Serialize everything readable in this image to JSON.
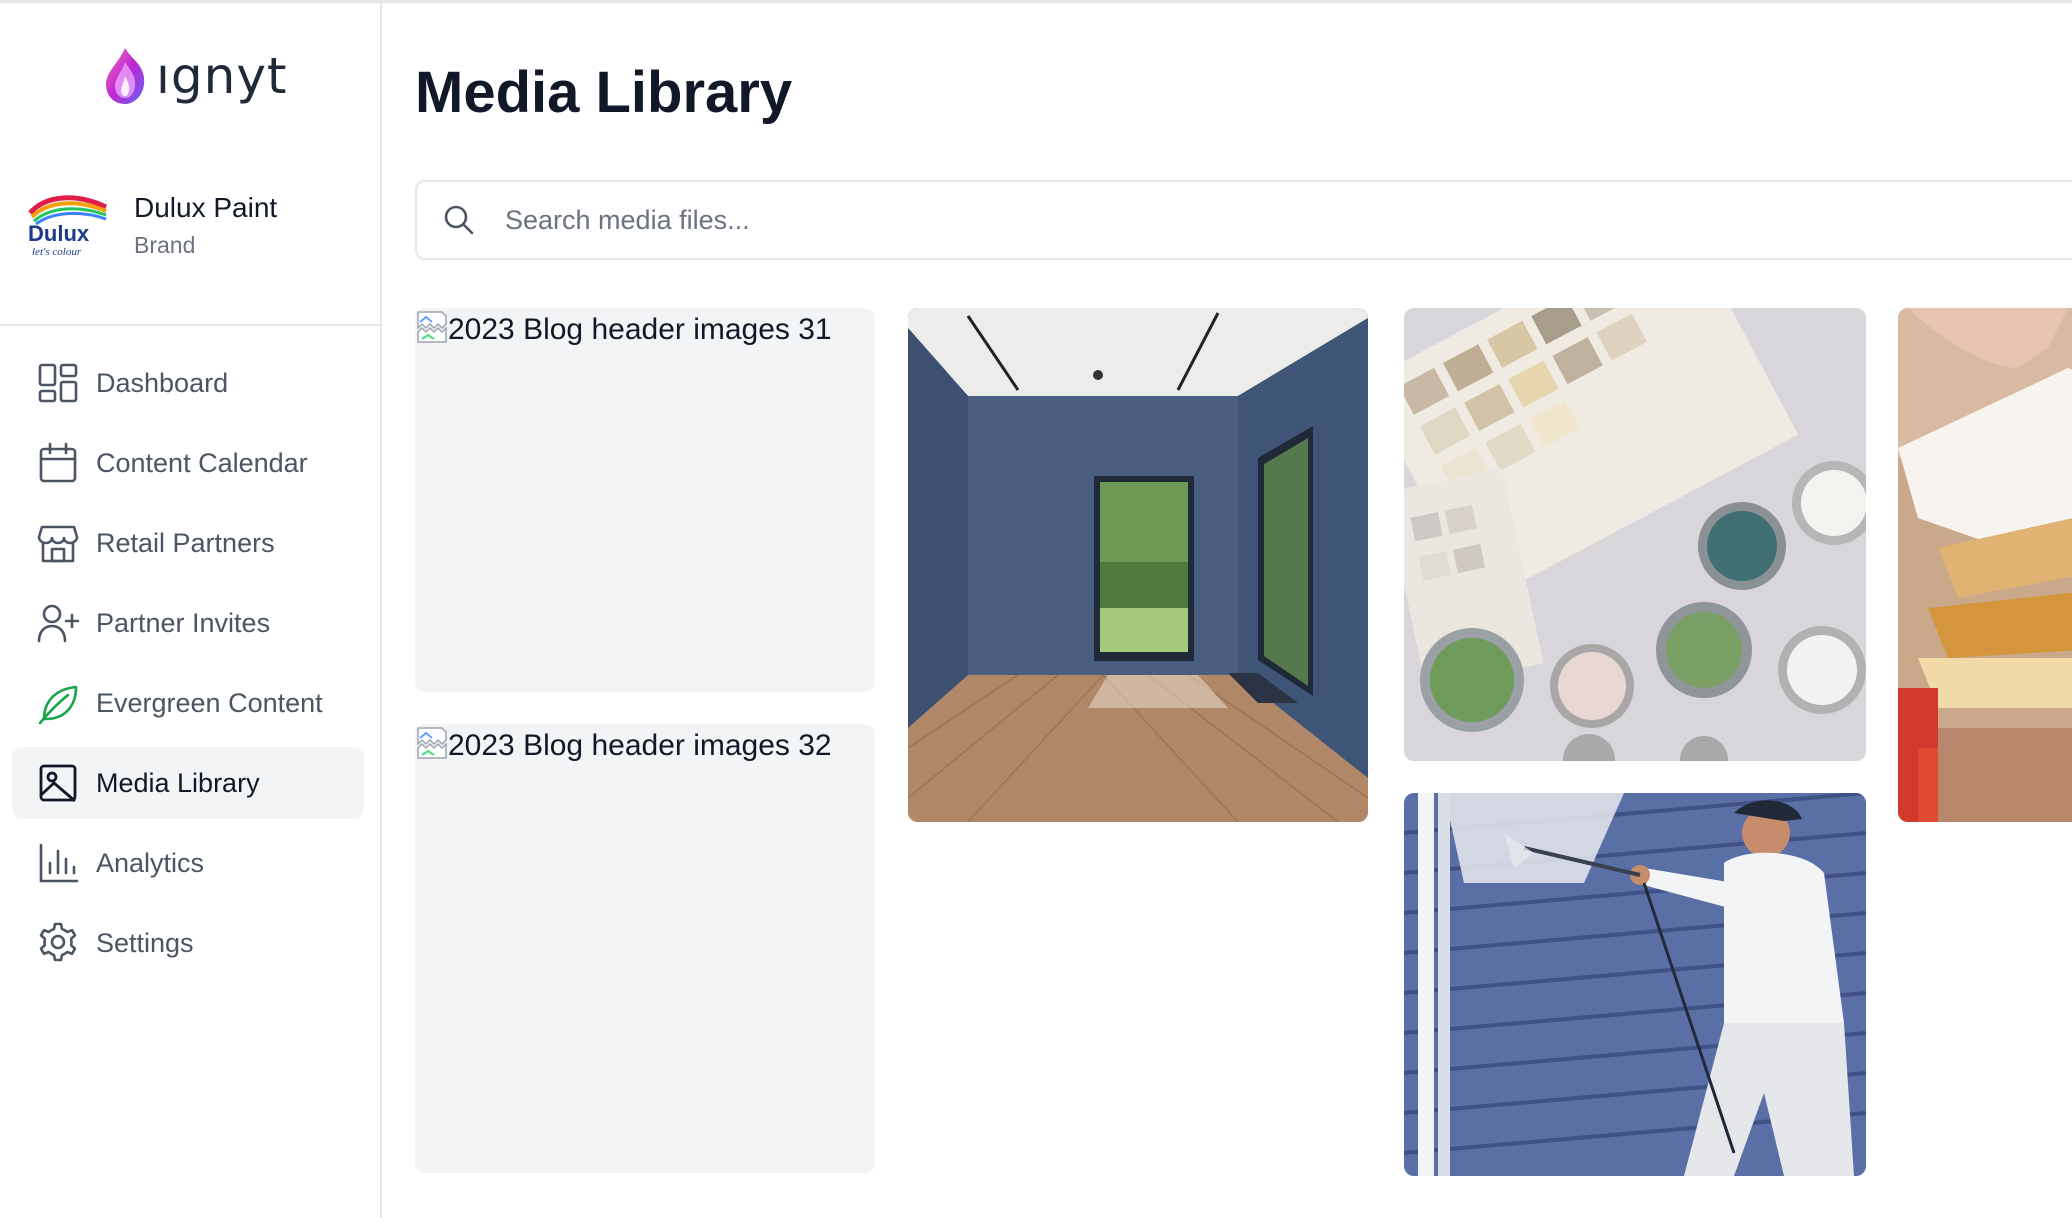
{
  "app": {
    "logo_text": "ıgnyt"
  },
  "brand": {
    "name": "Dulux Paint",
    "type": "Brand",
    "logo_text": "Dulux",
    "logo_tagline": "let's colour"
  },
  "nav": {
    "items": [
      {
        "label": "Dashboard",
        "icon": "dashboard-icon"
      },
      {
        "label": "Content Calendar",
        "icon": "calendar-icon"
      },
      {
        "label": "Retail Partners",
        "icon": "store-icon"
      },
      {
        "label": "Partner Invites",
        "icon": "user-plus-icon"
      },
      {
        "label": "Evergreen Content",
        "icon": "leaf-icon"
      },
      {
        "label": "Media Library",
        "icon": "image-icon",
        "active": true
      },
      {
        "label": "Analytics",
        "icon": "bar-chart-icon"
      },
      {
        "label": "Settings",
        "icon": "gear-icon"
      }
    ]
  },
  "page": {
    "title": "Media Library"
  },
  "search": {
    "placeholder": "Search media files...",
    "value": ""
  },
  "media": {
    "items": [
      {
        "alt": "2023 Blog header images 31",
        "state": "broken"
      },
      {
        "alt": "2023 Blog header images 32",
        "state": "broken"
      },
      {
        "subject": "blue room with herringbone floor"
      },
      {
        "subject": "paint swatches and paint tins"
      },
      {
        "subject": "painter spraying blue siding"
      },
      {
        "subject": "hand holding colour fan deck"
      }
    ]
  },
  "colors": {
    "accent_bg": "#f3f4f6",
    "border": "#e5e7eb",
    "text": "#111827",
    "muted": "#6b7280"
  }
}
